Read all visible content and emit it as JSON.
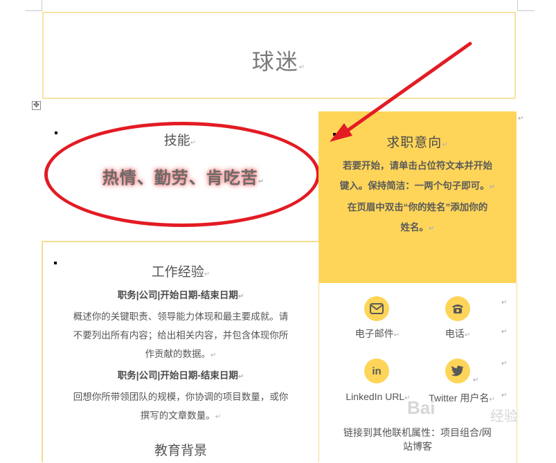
{
  "header": {
    "name": "球迷"
  },
  "skills": {
    "title": "技能",
    "text": "热情、勤劳、肯吃苦"
  },
  "objective": {
    "title": "求职意向",
    "line1": "若要开始，请单击占位符文本并开始",
    "line2": "键入。保持简洁：一两个句子即可。",
    "line3": "在页眉中双击“你的姓名”添加你的",
    "line4": "姓名。"
  },
  "experience": {
    "title": "工作经验",
    "job1_heading": "职务|公司|开始日期-结束日期",
    "job1_line1": "概述你的关键职责、领导能力体现和最主要成就。请",
    "job1_line2": "不要列出所有内容；给出相关内容，并包含体现你所",
    "job1_line3": "作贡献的数据。",
    "job2_heading": "职务|公司|开始日期-结束日期",
    "job2_line1": "回想你所带领团队的规模，你协调的项目数量，或你",
    "job2_line2": "撰写的文章数量。",
    "next_section_partial": "教育背景"
  },
  "contact": {
    "email_label": "电子邮件",
    "phone_label": "电话",
    "linkedin_label": "LinkedIn URL",
    "twitter_label": "Twitter 用户名",
    "other_line1": "链接到其他联机属性：项目组合/网",
    "other_line2": "站博客"
  },
  "marks": {
    "para": "↵",
    "cell_end": "↵",
    "table_move": "✥"
  },
  "watermark": {
    "brand": "Bai",
    "sub": "经验"
  },
  "colors": {
    "accent_yellow": "#fed559",
    "border_yellow": "#f3de8f",
    "annotation_red": "#e31b23"
  }
}
